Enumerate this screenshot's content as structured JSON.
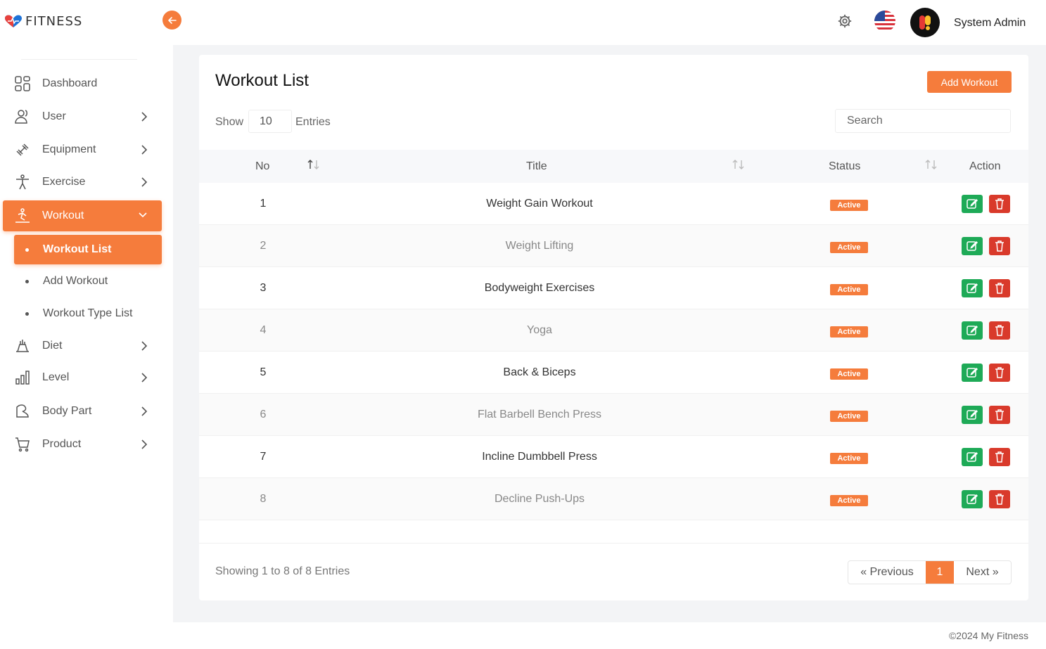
{
  "brand": {
    "logo_text": "FITNESS",
    "accent": "#f57c3c"
  },
  "header": {
    "user_name": "System Admin",
    "settings_icon": "gear-icon",
    "flag_icon": "us-flag-icon"
  },
  "sidebar": {
    "items": [
      {
        "label": "Dashboard",
        "icon": "dashboard-icon",
        "has_children": false
      },
      {
        "label": "User",
        "icon": "user-icon",
        "has_children": true
      },
      {
        "label": "Equipment",
        "icon": "equipment-icon",
        "has_children": true
      },
      {
        "label": "Exercise",
        "icon": "exercise-icon",
        "has_children": true
      },
      {
        "label": "Workout",
        "icon": "workout-icon",
        "has_children": true,
        "expanded": true,
        "active": true
      },
      {
        "label": "Diet",
        "icon": "diet-icon",
        "has_children": true
      },
      {
        "label": "Level",
        "icon": "level-icon",
        "has_children": true
      },
      {
        "label": "Body Part",
        "icon": "body-part-icon",
        "has_children": true
      },
      {
        "label": "Product",
        "icon": "product-icon",
        "has_children": true
      }
    ],
    "workout_sub": [
      {
        "label": "Workout List",
        "active": true
      },
      {
        "label": "Add Workout",
        "active": false
      },
      {
        "label": "Workout Type List",
        "active": false
      }
    ]
  },
  "main": {
    "title": "Workout List",
    "add_button": "Add Workout",
    "show_label": "Show",
    "entries_value": "10",
    "entries_label": "Entries",
    "search_placeholder": "Search",
    "columns": {
      "no": "No",
      "title": "Title",
      "status": "Status",
      "action": "Action"
    },
    "rows": [
      {
        "no": "1",
        "title": "Weight Gain Workout",
        "status": "Active"
      },
      {
        "no": "2",
        "title": "Weight Lifting",
        "status": "Active"
      },
      {
        "no": "3",
        "title": "Bodyweight Exercises",
        "status": "Active"
      },
      {
        "no": "4",
        "title": "Yoga",
        "status": "Active"
      },
      {
        "no": "5",
        "title": "Back & Biceps",
        "status": "Active"
      },
      {
        "no": "6",
        "title": "Flat Barbell Bench Press",
        "status": "Active"
      },
      {
        "no": "7",
        "title": "Incline Dumbbell Press",
        "status": "Active"
      },
      {
        "no": "8",
        "title": "Decline Push-Ups",
        "status": "Active"
      }
    ],
    "showing_text": "Showing 1 to 8 of 8 Entries",
    "pagination": {
      "prev": "« Previous",
      "current": "1",
      "next": "Next »"
    }
  },
  "footer": {
    "copyright": "©2024 My Fitness"
  }
}
